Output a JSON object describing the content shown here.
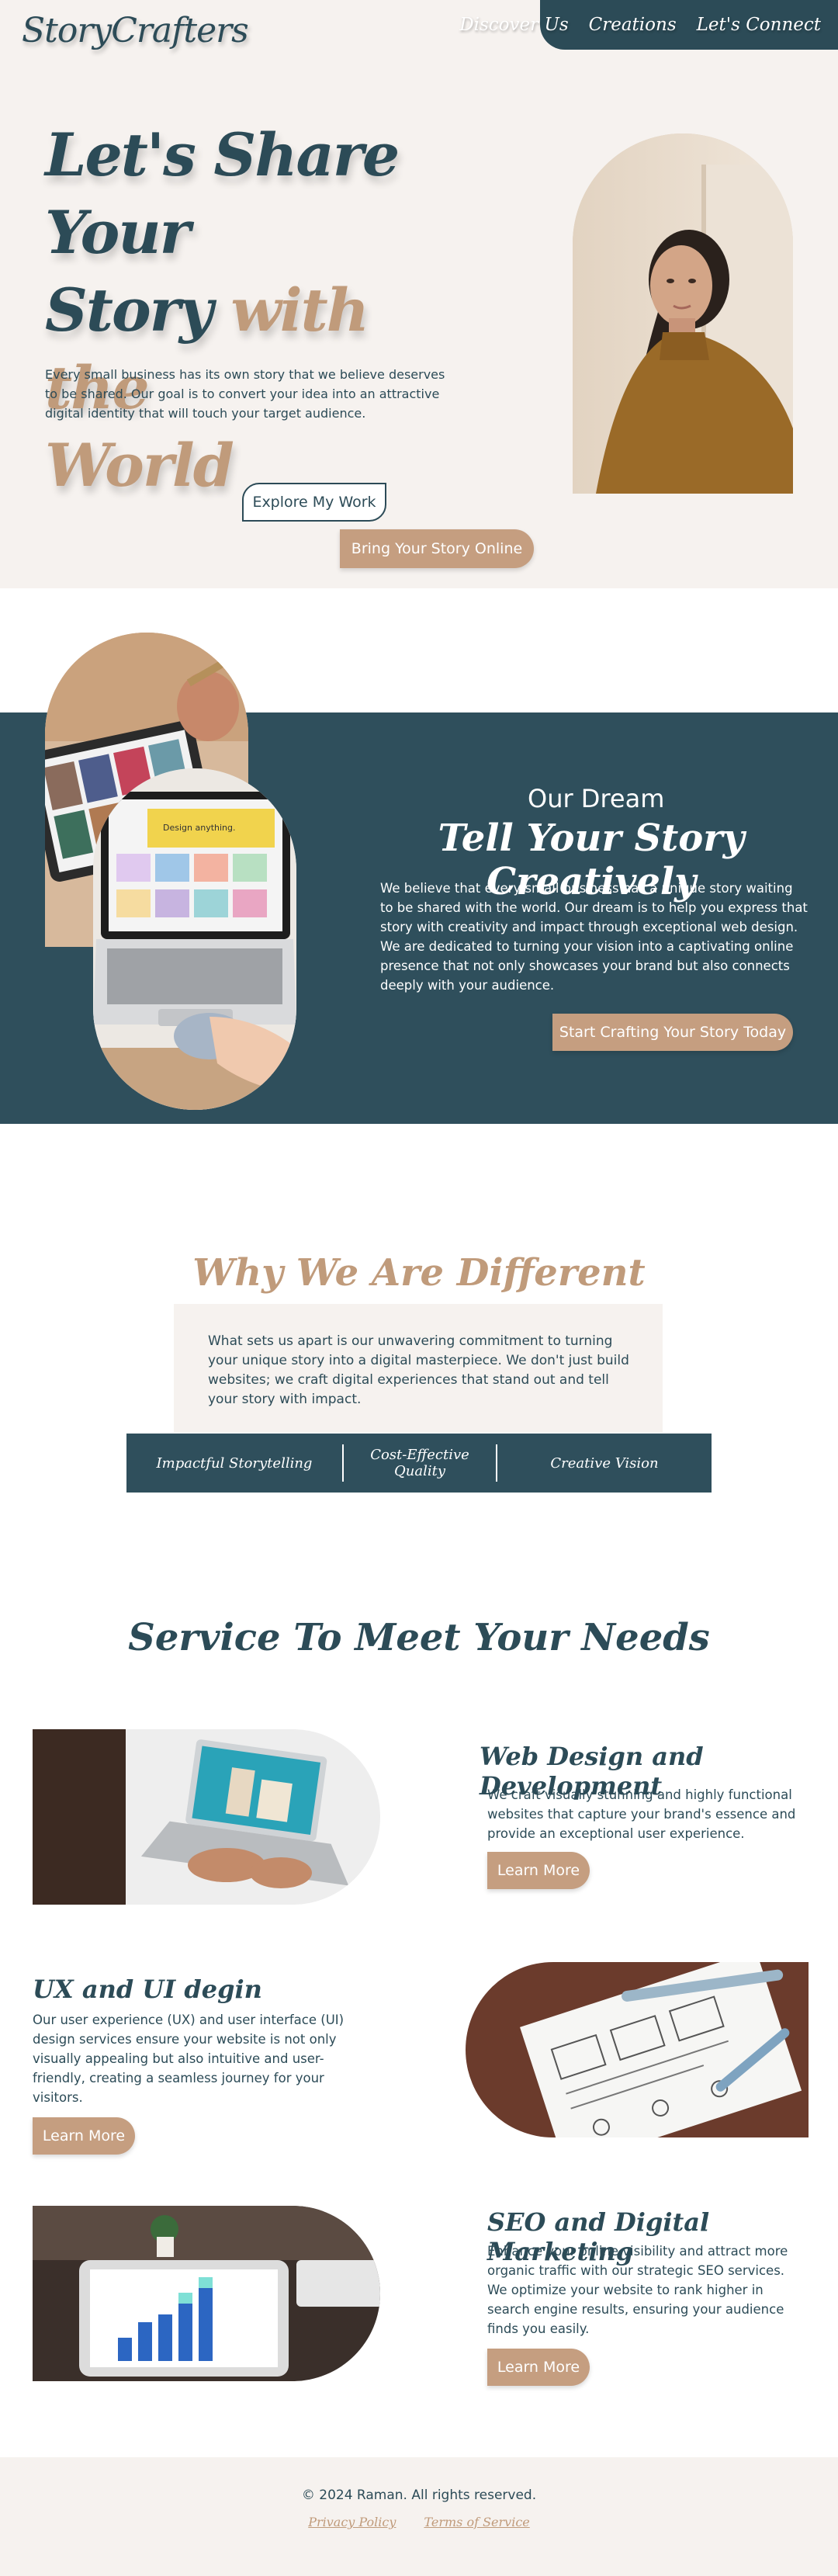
{
  "header": {
    "logo": "StoryCrafters",
    "nav": [
      "Discover Us",
      "Creations",
      "Let's Connect"
    ]
  },
  "hero": {
    "title_line1": "Let's Share Your",
    "title_line2a": "Story ",
    "title_line2b": "with the",
    "title_line3": "World",
    "description": "Every small business has its own story that we believe deserves to be shared. Our goal is to convert your idea into an attractive digital identity that will touch your target audience.",
    "explore_button": "Explore My Work",
    "online_button": "Bring Your Story Online"
  },
  "dream": {
    "subtitle": "Our Dream",
    "title": "Tell Your Story Creatively",
    "description": "We believe that every small business has a unique story waiting to be shared with the world. Our dream is to help you express that story with creativity and impact through exceptional web design. We are dedicated to turning your vision into a captivating online presence that not only showcases your brand but also connects deeply with your audience.",
    "button": "Start Crafting Your Story Today"
  },
  "different": {
    "title": "Why We Are Different",
    "text": "What sets us apart is our unwavering commitment to turning your unique story into a digital masterpiece. We don't just build websites; we craft digital experiences that stand out and tell your story with impact.",
    "items": [
      "Impactful Storytelling",
      "Cost-Effective Quality",
      "Creative Vision"
    ]
  },
  "services": {
    "title": "Service To Meet Your Needs",
    "items": [
      {
        "title": "Web Design and Development",
        "text": "We craft visually stunning and highly functional websites that capture your brand's essence and provide an exceptional user experience.",
        "button": "Learn More"
      },
      {
        "title": "UX and UI degin",
        "text": "Our user experience (UX) and user interface (UI) design services ensure your website is not only visually appealing but also intuitive and user-friendly, creating a seamless journey for your visitors.",
        "button": "Learn More"
      },
      {
        "title": "SEO and Digital Marketing",
        "text": "Enhance your online visibility and attract more organic traffic with our strategic SEO services. We optimize your website to rank higher in search engine results, ensuring your audience finds you easily.",
        "button": "Learn More"
      }
    ]
  },
  "footer": {
    "copyright": "© 2024 Raman. All rights reserved.",
    "links": [
      "Privacy Policy",
      "Terms of Service"
    ]
  },
  "colors": {
    "primary": "#2c4b57",
    "accent": "#c09b7b",
    "cream": "#f6f2ef"
  }
}
